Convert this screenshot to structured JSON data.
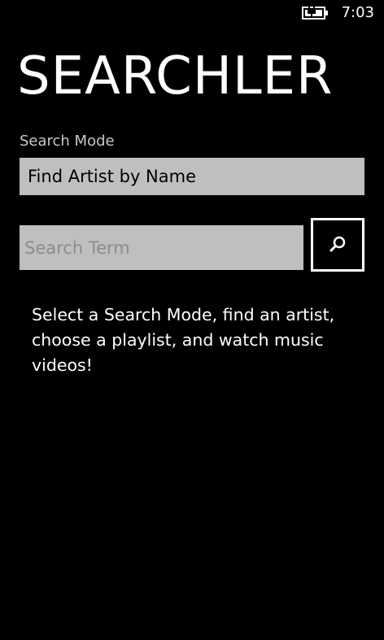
{
  "status_bar": {
    "time": "7:03",
    "battery_icon": "battery-charging-icon"
  },
  "app": {
    "title": "SEARCHLER"
  },
  "search_mode": {
    "label": "Search Mode",
    "selected": "Find Artist by Name"
  },
  "search": {
    "value": "",
    "placeholder": "Search Term",
    "button_icon": "search-icon"
  },
  "instructions": "Select a Search Mode, find an artist, choose a playlist, and watch music videos!",
  "colors": {
    "background": "#000000",
    "field_background": "#bfbfbf",
    "placeholder": "#8c8c8c",
    "label": "#c8c8c8",
    "text": "#ffffff"
  }
}
